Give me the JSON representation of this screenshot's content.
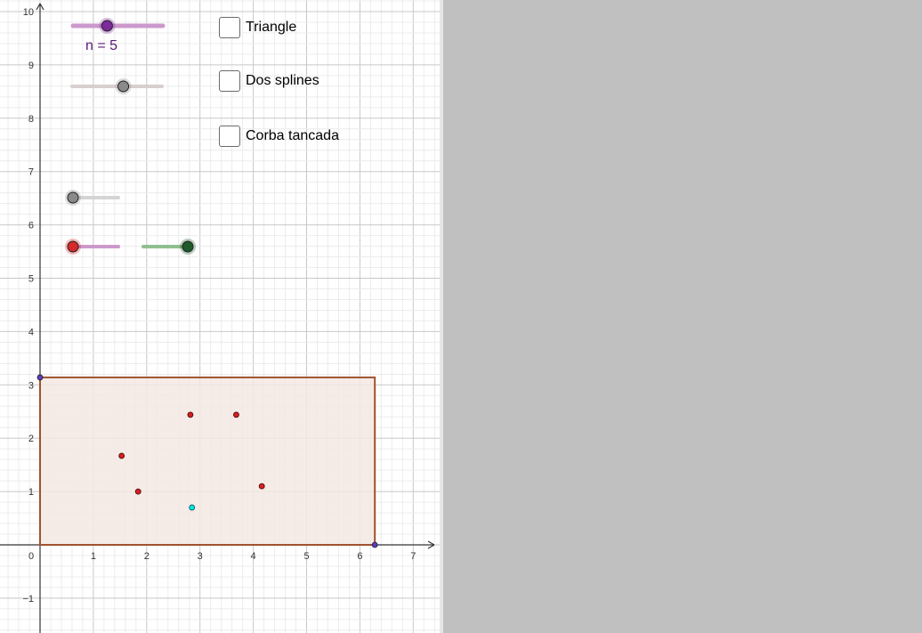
{
  "axes": {
    "x_ticks": [
      "0",
      "1",
      "2",
      "3",
      "4",
      "5",
      "6",
      "7"
    ],
    "y_ticks": [
      "−1",
      "1",
      "2",
      "3",
      "4",
      "5",
      "6",
      "7",
      "8",
      "9",
      "10"
    ],
    "x_range": [
      -0.75,
      7.45
    ],
    "y_range": [
      -1.6,
      10.2
    ],
    "grid": true,
    "minor_grid_divisions": 5
  },
  "slider_n": {
    "caption": "n = 5",
    "value": 5,
    "position_fraction": 0.38,
    "color": "#7d2a9c",
    "track_color": "#cc99cc"
  },
  "sliders": [
    {
      "name": "grey-slider-top",
      "position_fraction": 0.57,
      "color": "#8a8a8a",
      "track_color": "#d8cfcf"
    },
    {
      "name": "grey-slider-middle",
      "position_fraction": 0.0,
      "color": "#8a8a8a",
      "track_color": "#d4d4d4"
    },
    {
      "name": "red-slider",
      "position_fraction": 0.0,
      "color": "#d42a2a",
      "track_color": "#cc99cc"
    },
    {
      "name": "green-slider",
      "position_fraction": 1.0,
      "color": "#1f5a2a",
      "track_color": "#8fbf8f"
    }
  ],
  "checkboxes": [
    {
      "label": "Triangle",
      "checked": false
    },
    {
      "label": "Dos splines",
      "checked": false
    },
    {
      "label": "Corba tancada",
      "checked": false
    }
  ],
  "rectangle": {
    "x0": 0,
    "y0": 0,
    "x1": 6.28,
    "y1": 3.14,
    "stroke": "#a0522d",
    "fill": "#f3e8e3"
  },
  "corner_points": [
    {
      "x": 0,
      "y": 3.14,
      "color": "#5b3cc4"
    },
    {
      "x": 6.28,
      "y": 0,
      "color": "#5b3cc4"
    }
  ],
  "red_points": [
    {
      "x": 1.53,
      "y": 1.67
    },
    {
      "x": 1.84,
      "y": 1.0
    },
    {
      "x": 2.82,
      "y": 2.44
    },
    {
      "x": 3.68,
      "y": 2.44
    },
    {
      "x": 4.16,
      "y": 1.1
    }
  ],
  "cyan_point": {
    "x": 2.85,
    "y": 0.7,
    "color": "#00e5e5"
  },
  "colors": {
    "red_point": "#d42020",
    "right_panel": "#c0c0c0"
  }
}
